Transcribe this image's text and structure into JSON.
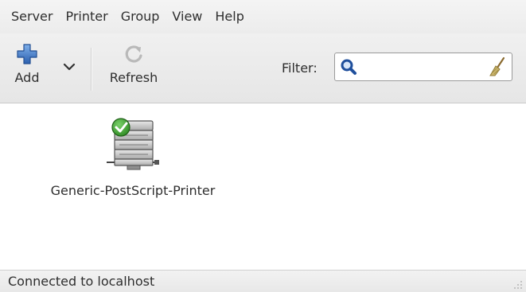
{
  "menubar": {
    "items": [
      "Server",
      "Printer",
      "Group",
      "View",
      "Help"
    ]
  },
  "toolbar": {
    "add_label": "Add",
    "refresh_label": "Refresh",
    "filter_label": "Filter:",
    "filter_value": "",
    "icons": {
      "add": "plus-icon",
      "add_menu": "chevron-down-icon",
      "refresh": "refresh-icon",
      "search": "search-icon",
      "clear": "broom-clear-icon"
    }
  },
  "printers": [
    {
      "name": "Generic-PostScript-Printer",
      "icon": "printer-icon",
      "status_icon": "check-icon",
      "default": true
    }
  ],
  "statusbar": {
    "text": "Connected to localhost"
  },
  "colors": {
    "accent_blue": "#3a6fc0",
    "check_green": "#3c9a2e"
  }
}
